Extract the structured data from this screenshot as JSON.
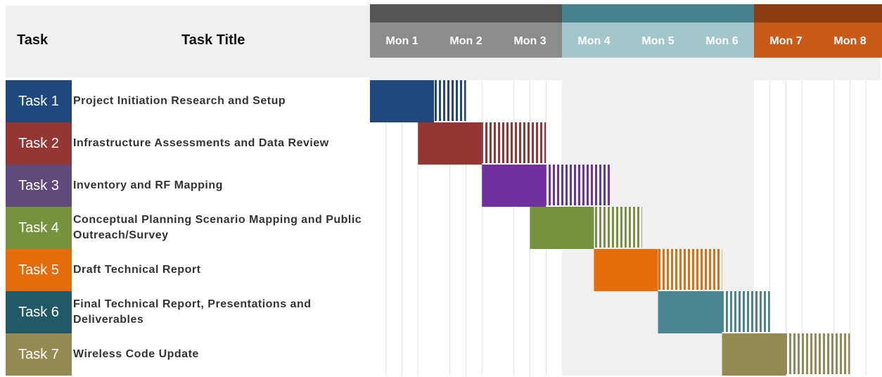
{
  "headers": {
    "task": "Task",
    "task_title": "Task Title"
  },
  "month_groups": [
    {
      "color": "#555555",
      "label_bg": "#8c8c8c",
      "months": [
        "Mon 1",
        "Mon 2",
        "Mon 3"
      ]
    },
    {
      "color": "#46838f",
      "label_bg": "#a3c6cb",
      "months": [
        "Mon 4",
        "Mon 5",
        "Mon 6"
      ]
    },
    {
      "color": "#8a3d0f",
      "label_bg": "#c95a17",
      "months": [
        "Mon 7",
        "Mon 8"
      ]
    }
  ],
  "tasks": [
    {
      "id": "Task 1",
      "title": "Project Initiation Research and Setup",
      "color": "#1f497d",
      "start_month": 1,
      "solid_months": 1,
      "hatched_months": 0.5
    },
    {
      "id": "Task 2",
      "title": "Infrastructure Assessments and Data Review",
      "color": "#963634",
      "start_month": 1.75,
      "solid_months": 1,
      "hatched_months": 1
    },
    {
      "id": "Task 3",
      "title": "Inventory and RF Mapping",
      "color": "#7030a0",
      "start_month": 2.75,
      "solid_months": 1,
      "hatched_months": 1
    },
    {
      "id": "Task 4",
      "title": "Conceptual Planning Scenario Mapping and Public Outreach/Survey",
      "color": "#76923c",
      "start_month": 3.5,
      "solid_months": 1,
      "hatched_months": 0.75
    },
    {
      "id": "Task 5",
      "title": "Draft Technical Report",
      "color": "#e46c0a",
      "start_month": 4.5,
      "solid_months": 1,
      "hatched_months": 1
    },
    {
      "id": "Task 6",
      "title": "Final Technical Report, Presentations and Deliverables",
      "color": "#4a8592",
      "start_month": 5.5,
      "solid_months": 1,
      "hatched_months": 0.75
    },
    {
      "id": "Task 7",
      "title": "Wireless Code Update",
      "color": "#948a54",
      "start_month": 6.5,
      "solid_months": 1,
      "hatched_months": 1
    }
  ],
  "task_id_colors": [
    "#1f497d",
    "#963634",
    "#604a7b",
    "#76923c",
    "#e46c0a",
    "#215967",
    "#948a54"
  ]
}
